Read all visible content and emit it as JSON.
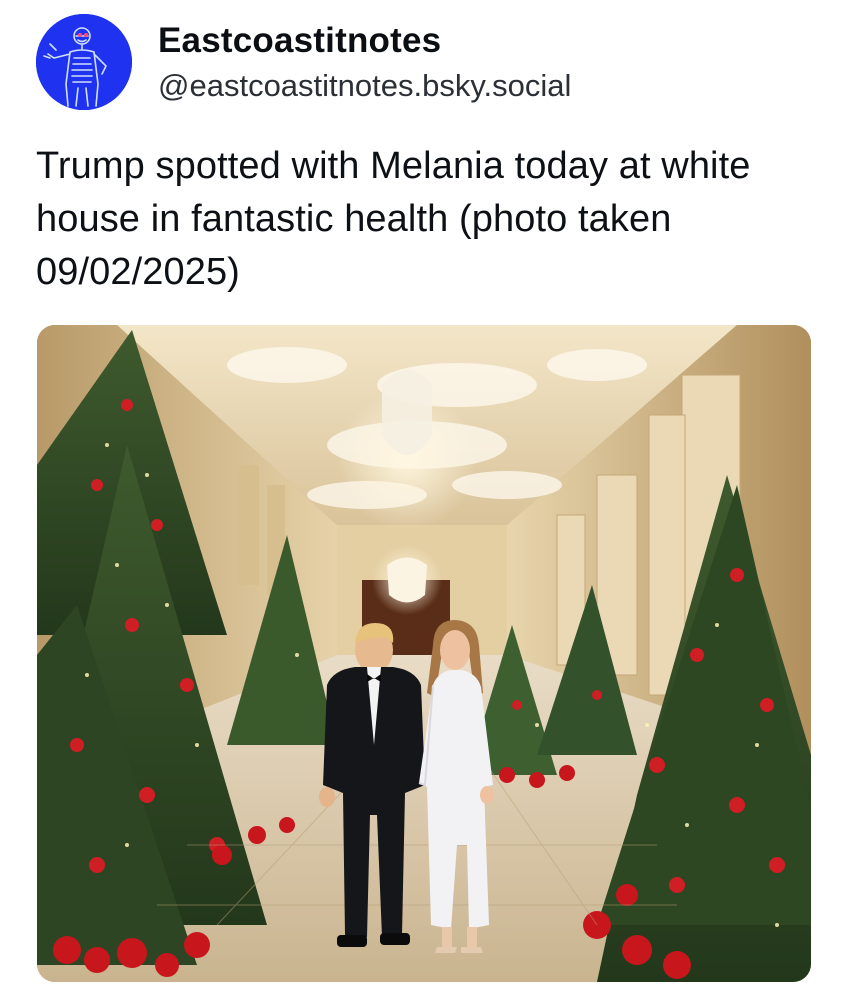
{
  "post": {
    "author": {
      "display_name": "Eastcoastitnotes",
      "handle": "@eastcoastitnotes.bsky.social"
    },
    "text": "Trump spotted with Melania today at white house in fantastic health (photo taken 09/02/2025)"
  },
  "colors": {
    "avatar_bg": "#1a2ae0",
    "text": "#0b0f14",
    "handle": "#2b2f36",
    "background": "#ffffff"
  },
  "image": {
    "scene": "white-house-cross-hall-christmas-trees-couple"
  }
}
